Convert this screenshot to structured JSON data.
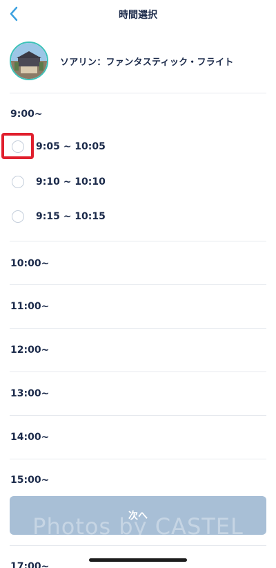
{
  "header": {
    "title": "時間選択",
    "back_icon": "chevron-left-icon"
  },
  "attraction": {
    "name": "ソアリン：ファンタスティック・フライト",
    "image": "attraction-photo"
  },
  "time_groups": [
    {
      "label": "9:00~",
      "slots": [
        "9:05 ~ 10:05",
        "9:10 ~ 10:10",
        "9:15 ~ 10:15"
      ]
    },
    {
      "label": "10:00~"
    },
    {
      "label": "11:00~"
    },
    {
      "label": "12:00~"
    },
    {
      "label": "13:00~"
    },
    {
      "label": "14:00~"
    },
    {
      "label": "15:00~"
    },
    {
      "label": "17:00~"
    }
  ],
  "next_button": {
    "label": "次へ"
  },
  "watermark": "Photos by CASTEL",
  "colors": {
    "accent": "#3aa0e0",
    "text": "#1b2a4a",
    "button_disabled": "#a8bfd6",
    "highlight": "#e01f2d",
    "avatar_ring": "#3cc2b8"
  }
}
